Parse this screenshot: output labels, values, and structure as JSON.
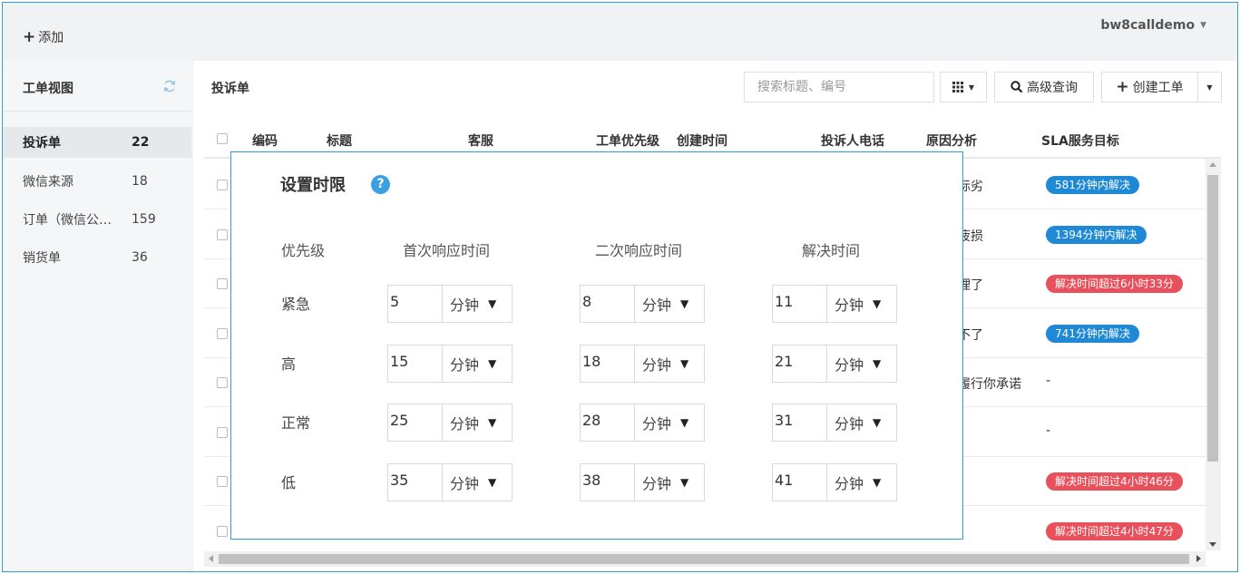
{
  "topbar": {
    "add_label": "添加",
    "user_label": "bw8calldemo"
  },
  "sidebar": {
    "title": "工单视图",
    "items": [
      {
        "label": "投诉单",
        "count": "22"
      },
      {
        "label": "微信来源",
        "count": "18"
      },
      {
        "label": "订单（微信公…",
        "count": "159"
      },
      {
        "label": "销货单",
        "count": "36"
      }
    ]
  },
  "main": {
    "title": "投诉单",
    "search_placeholder": "搜索标题、编号",
    "advanced_search_label": "高级查询",
    "create_label": "创建工单",
    "columns": [
      "编码",
      "标题",
      "客服",
      "工单优先级",
      "创建时间",
      "投诉人电话",
      "原因分析",
      "SLA服务目标"
    ],
    "rows": [
      {
        "reason": "际劣",
        "sla": "581分钟内解决",
        "sla_status": "blue"
      },
      {
        "reason": "疲损",
        "sla": "1394分钟内解决",
        "sla_status": "blue"
      },
      {
        "reason": "理了",
        "sla": "解决时间超过6小时33分",
        "sla_status": "red"
      },
      {
        "reason": "不了",
        "sla": "741分钟内解决",
        "sla_status": "blue"
      },
      {
        "reason": "履行你承诺",
        "sla": "-",
        "sla_status": "none"
      },
      {
        "reason": "",
        "sla": "-",
        "sla_status": "none"
      },
      {
        "reason": "",
        "sla": "解决时间超过4小时46分",
        "sla_status": "red"
      },
      {
        "reason": "",
        "sla": "解决时间超过4小时47分",
        "sla_status": "red"
      }
    ]
  },
  "modal": {
    "title": "设置时限",
    "help_icon": "?",
    "headers": {
      "priority": "优先级",
      "first_response": "首次响应时间",
      "second_response": "二次响应时间",
      "resolve": "解决时间"
    },
    "rows": [
      {
        "priority": "紧急",
        "first": "5",
        "second": "8",
        "resolve": "11"
      },
      {
        "priority": "高",
        "first": "15",
        "second": "18",
        "resolve": "21"
      },
      {
        "priority": "正常",
        "first": "25",
        "second": "28",
        "resolve": "31"
      },
      {
        "priority": "低",
        "first": "35",
        "second": "38",
        "resolve": "41"
      }
    ],
    "unit_label": "分钟",
    "dropdown_glyph": "▼"
  },
  "colors": {
    "accent": "#2fa4c7",
    "badge_blue": "#2089d5",
    "badge_red": "#e8505b",
    "help": "#3aa0e0"
  }
}
